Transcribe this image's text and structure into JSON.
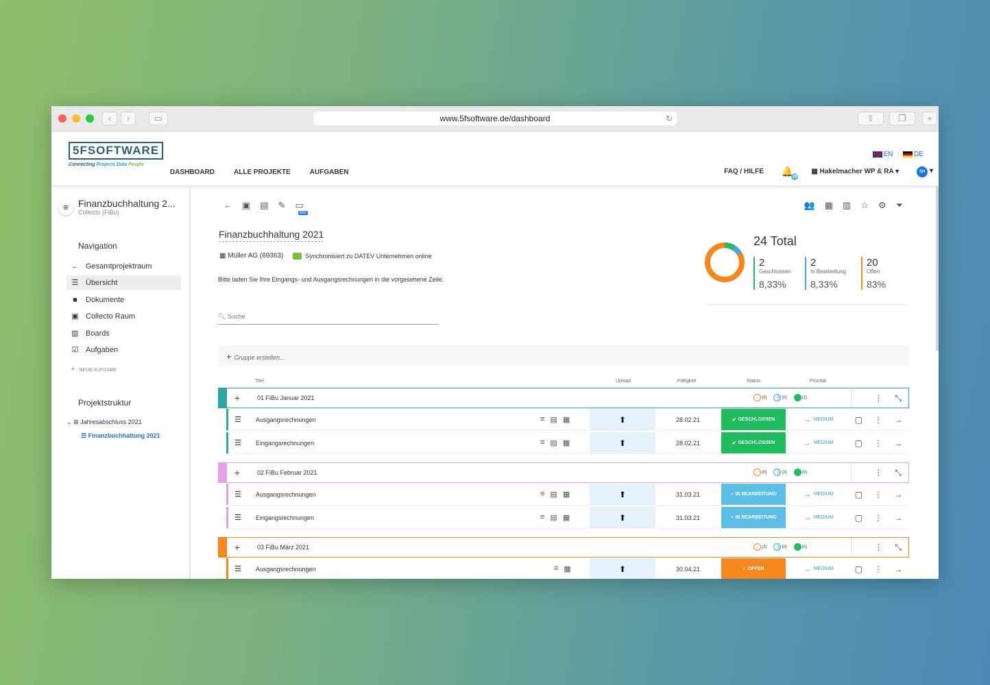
{
  "browser": {
    "url": "www.5fsoftware.de/dashboard"
  },
  "logo": {
    "brand": "5FSOFTWARE",
    "tagline_1": "Connecting ",
    "tagline_2": "Projects ",
    "tagline_3": "Data ",
    "tagline_4": "People"
  },
  "nav": {
    "items": [
      "DASHBOARD",
      "ALLE PROJEKTE",
      "AUFGABEN"
    ],
    "faq": "FAQ / HILFE",
    "notifications": "19",
    "company": "Hakelmacher WP & RA",
    "user_initials": "SH",
    "lang_en": "EN",
    "lang_de": "DE"
  },
  "sidebar": {
    "title": "Finanzbuchhaltung 2...",
    "subtitle": "Collecto (FiBu)",
    "navigation_heading": "Navigation",
    "items": [
      {
        "label": "Gesamtprojektraum",
        "icon": "arrow-left-icon"
      },
      {
        "label": "Übersicht",
        "icon": "list-check-icon"
      },
      {
        "label": "Dokumente",
        "icon": "document-icon"
      },
      {
        "label": "Collecto Raum",
        "icon": "room-icon"
      },
      {
        "label": "Boards",
        "icon": "board-icon"
      },
      {
        "label": "Aufgaben",
        "icon": "task-icon"
      }
    ],
    "new_task": "NEUE AUFGABE",
    "structure_heading": "Projektstruktur",
    "tree_parent": "Jahresabschluss 2021",
    "tree_child": "Finanzbuchhaltung 2021"
  },
  "project": {
    "title": "Finanzbuchhaltung 2021",
    "client": "Müller AG (69363)",
    "sync": "Synchronisiert zu DATEV Unternehmen online",
    "hint": "Bitte laden Sie Ihre Eingangs- und Ausgangsrechnungen in die vorgesehene Zeile.",
    "doc_badge": "12",
    "beta": "beta"
  },
  "stats": {
    "total": "24 Total",
    "closed_n": "2",
    "closed_l": "Geschlossen",
    "closed_p": "8,33%",
    "progress_n": "2",
    "progress_l": "In Bearbeitung",
    "progress_p": "8,33%",
    "open_n": "20",
    "open_l": "Offen",
    "open_p": "83%",
    "colors": {
      "closed": "#1fbd5e",
      "progress": "#4aa8d8",
      "open": "#f7861c"
    }
  },
  "search": {
    "placeholder": "Suche"
  },
  "group_create": "Gruppe erstellen...",
  "columns": {
    "title": "Titel",
    "upload": "Upload",
    "due": "Fälligkeit",
    "status": "Status",
    "priority": "Priorität"
  },
  "groups": [
    {
      "name": "01 FiBu Januar 2021",
      "color": "#2aa8a8",
      "open": "(0)",
      "progress": "(0)",
      "closed": "(2)",
      "tasks": [
        {
          "name": "Ausgangsrechnungen",
          "date": "28.02.21",
          "status": "GESCHLOSSEN",
          "status_color": "#1fbd5e",
          "prio": "MEDIUM"
        },
        {
          "name": "Eingangsrechnungen",
          "date": "28.02.21",
          "status": "GESCHLOSSEN",
          "status_color": "#1fbd5e",
          "prio": "MEDIUM"
        }
      ]
    },
    {
      "name": "02 FiBu Februar 2021",
      "color": "#e4a0e8",
      "open": "(0)",
      "progress": "(2)",
      "closed": "(0)",
      "tasks": [
        {
          "name": "Ausgangsrechnungen",
          "date": "31.03.21",
          "status": "IN BEARBEITUNG",
          "status_color": "#5bbfe8",
          "prio": "MEDIUM"
        },
        {
          "name": "Eingangsrechnungen",
          "date": "31.03.21",
          "status": "IN BEARBEITUNG",
          "status_color": "#5bbfe8",
          "prio": "MEDIUM"
        }
      ]
    },
    {
      "name": "03 FiBu März 2021",
      "color": "#f7861c",
      "open": "(2)",
      "progress": "(0)",
      "closed": "(0)",
      "tasks": [
        {
          "name": "Ausgangsrechnungen",
          "date": "30.04.21",
          "status": "OFFEN",
          "status_color": "#f7861c",
          "prio": "MEDIUM"
        }
      ]
    }
  ]
}
